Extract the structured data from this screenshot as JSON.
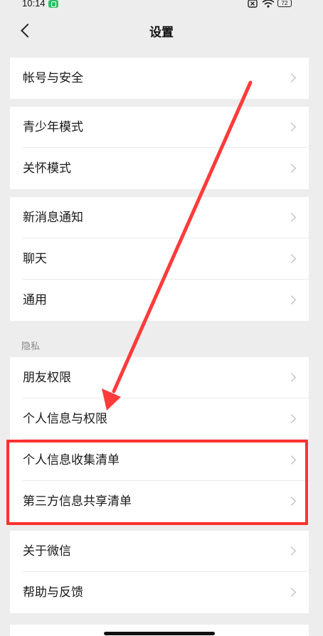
{
  "status_bar": {
    "time": "10:14",
    "battery": "72"
  },
  "nav": {
    "title": "设置"
  },
  "groups": {
    "account": {
      "items": [
        "帐号与安全"
      ]
    },
    "modes": {
      "items": [
        "青少年模式",
        "关怀模式"
      ]
    },
    "general": {
      "items": [
        "新消息通知",
        "聊天",
        "通用"
      ]
    },
    "privacy": {
      "header": "隐私",
      "items": [
        "朋友权限",
        "个人信息与权限",
        "个人信息收集清单",
        "第三方信息共享清单"
      ]
    },
    "about": {
      "items": [
        "关于微信",
        "帮助与反馈"
      ]
    }
  },
  "annotation": {
    "highlight_color": "#ff3131"
  },
  "colors": {
    "background": "#ededed",
    "card": "#ffffff",
    "chevron": "#b2b2b2"
  }
}
